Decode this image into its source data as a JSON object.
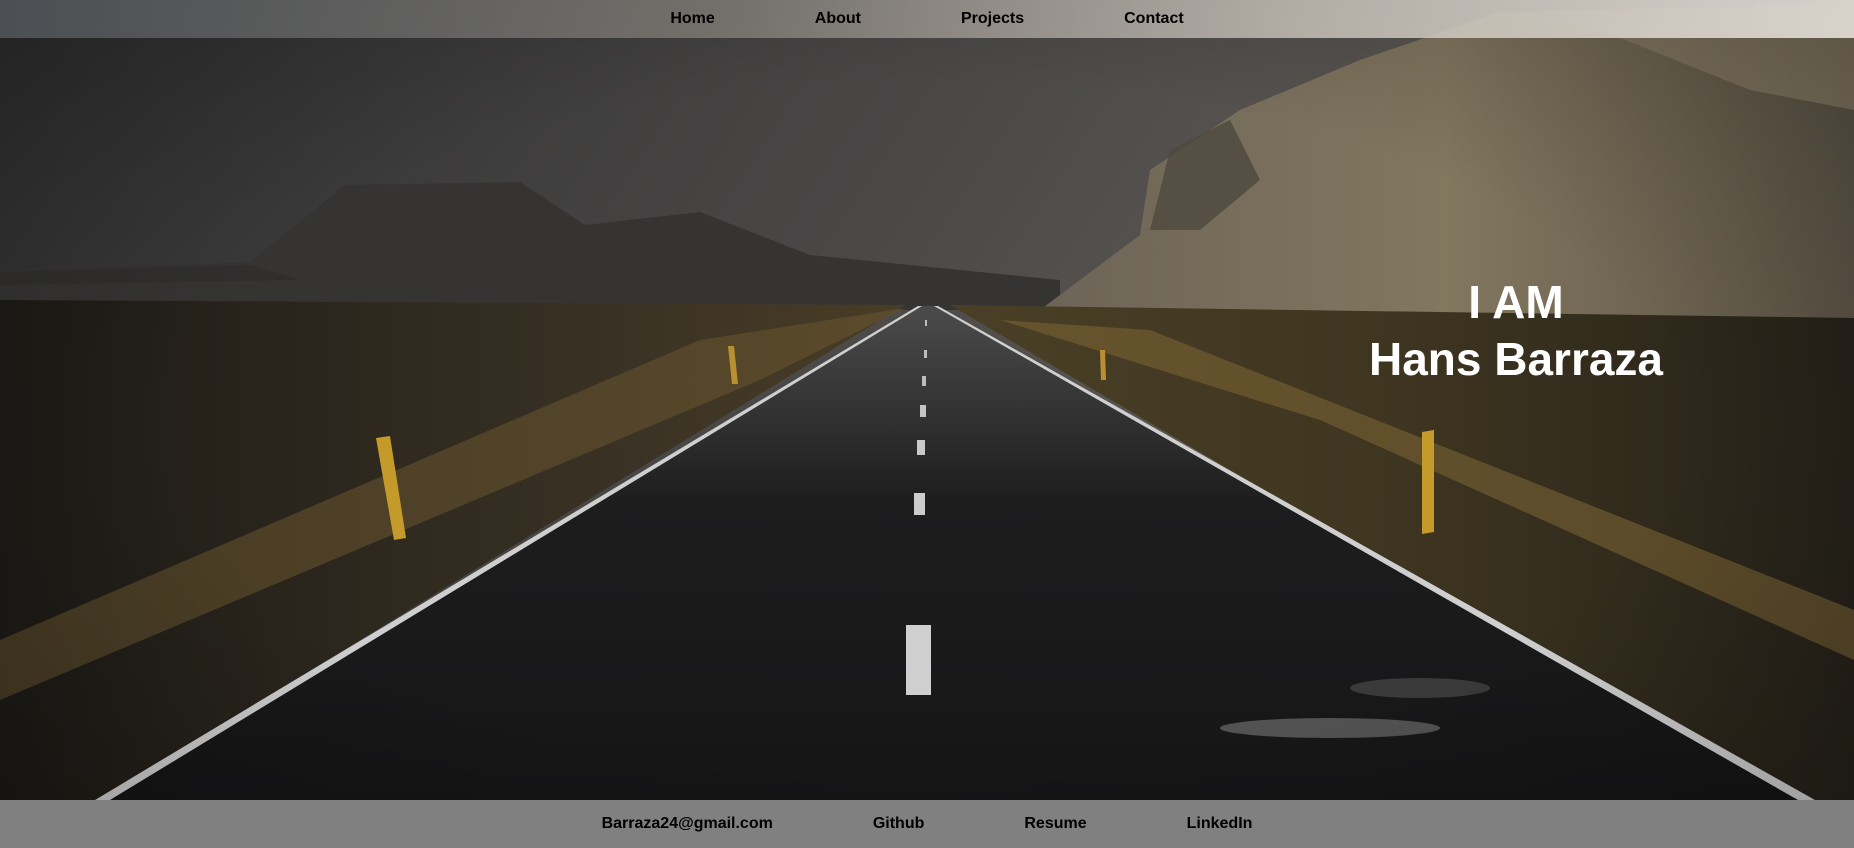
{
  "nav": {
    "items": [
      {
        "label": "Home"
      },
      {
        "label": "About"
      },
      {
        "label": "Projects"
      },
      {
        "label": "Contact"
      }
    ]
  },
  "hero": {
    "line1": "I AM",
    "line2": "Hans Barraza",
    "background": "dark-road-mountain-landscape"
  },
  "footer": {
    "links": [
      {
        "label": "Barraza24@gmail.com"
      },
      {
        "label": "Github"
      },
      {
        "label": "Resume"
      },
      {
        "label": "LinkedIn"
      }
    ]
  }
}
